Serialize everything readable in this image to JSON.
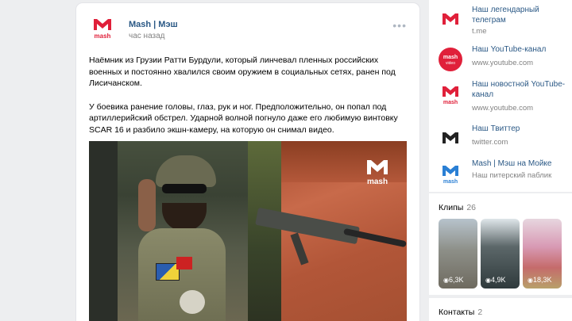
{
  "post": {
    "author": "Mash | Мэш",
    "time": "час назад",
    "more": "•••",
    "paragraph1": "Наёмник из Грузии Ратти Бурдули, который линчевал пленных российских военных и постоянно хвалился своим оружием в социальных сетях, ранен под Лисичанском.",
    "paragraph2": "У боевика ранение головы, глаз, рук и ног. Предположительно, он попал под артиллерийский обстрел. Ударной волной погнуло даже его любимую винтовку SCAR 16 и разбило экшн-камеру, на которую он снимал видео.",
    "watermark": "mash"
  },
  "sidebar": {
    "links": [
      {
        "title": "Наш легендарный телеграм",
        "url": "t.me",
        "icon": "mash-logo-icon"
      },
      {
        "title": "Наш YouTube-канал",
        "url": "www.youtube.com",
        "icon": "mash-video-icon"
      },
      {
        "title": "Наш новостной YouTube-канал",
        "url": "www.youtube.com",
        "icon": "mash-logo-icon"
      },
      {
        "title": "Наш Твиттер",
        "url": "twitter.com",
        "icon": "mash-dark-icon"
      },
      {
        "title": "Mash | Мэш на Мойке",
        "url": "Наш питерский паблик",
        "icon": "mash-blue-icon"
      }
    ],
    "clips": {
      "title": "Клипы",
      "count": "26",
      "items": [
        {
          "views": "6,3K"
        },
        {
          "views": "4,9K"
        },
        {
          "views": "18,3K"
        }
      ]
    },
    "contacts": {
      "title": "Контакты",
      "count": "2"
    }
  },
  "colors": {
    "link": "#2a5885",
    "brand_red": "#e0203a",
    "muted": "#828282",
    "background": "#edeef0"
  }
}
